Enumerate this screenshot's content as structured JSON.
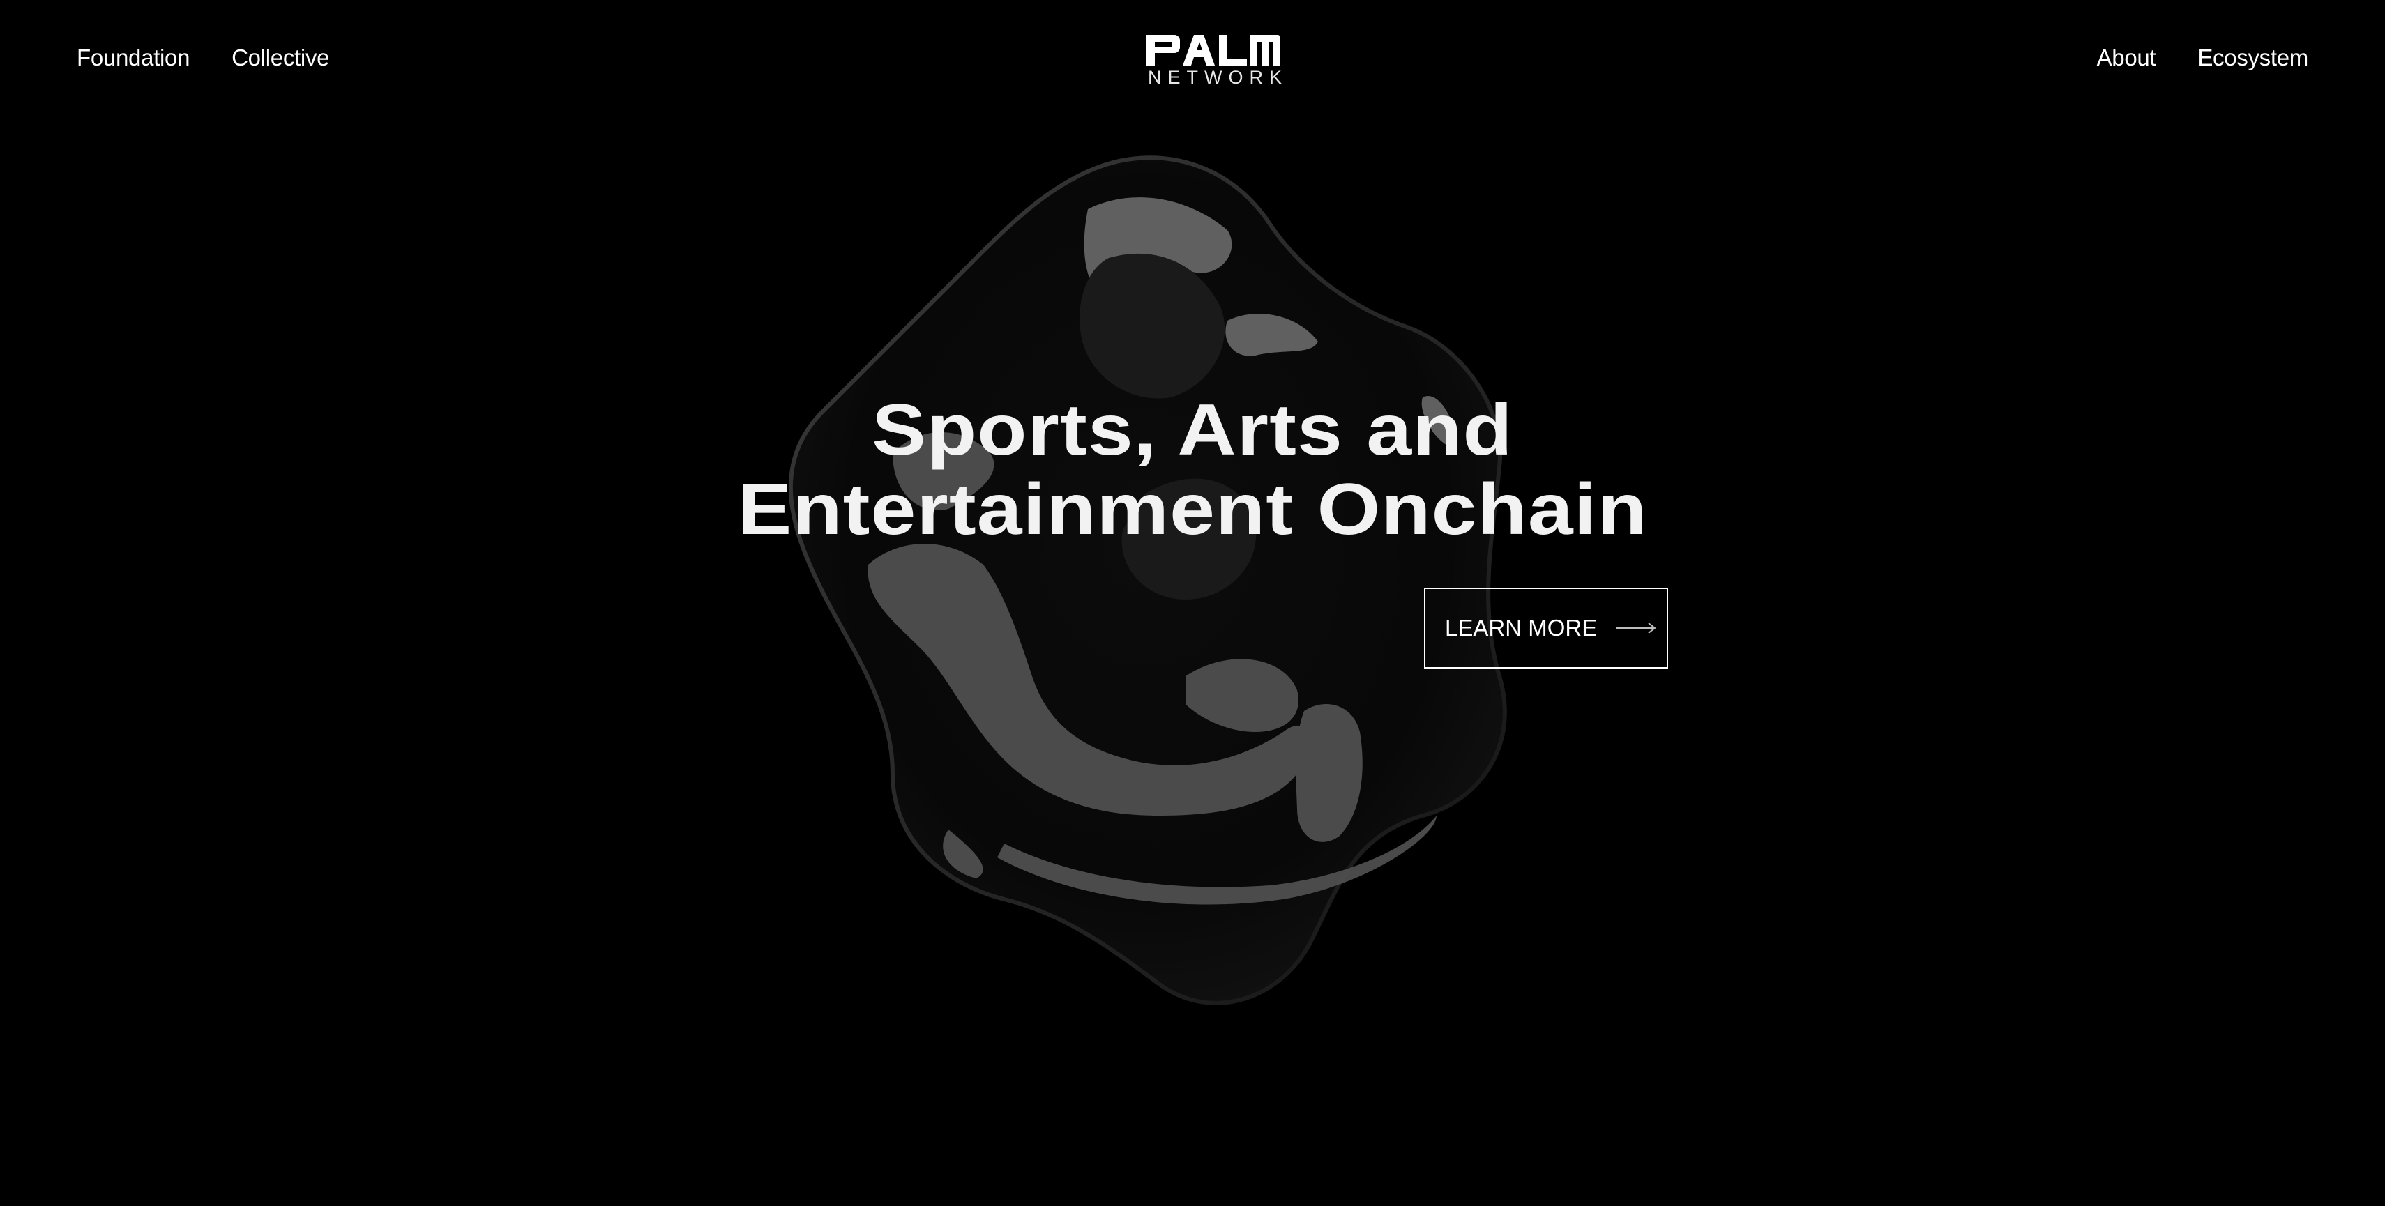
{
  "nav_left": [
    {
      "label": "Foundation"
    },
    {
      "label": "Collective"
    }
  ],
  "nav_right": [
    {
      "label": "About"
    },
    {
      "label": "Ecosystem"
    }
  ],
  "logo": {
    "mark_text": "PALM",
    "subtext": "NETWORK"
  },
  "hero": {
    "title_line1": "Sports, Arts and",
    "title_line2": "Entertainment Onchain",
    "cta_label": "LEARN MORE",
    "cta_icon": "arrow-right-icon"
  },
  "colors": {
    "background": "#000000",
    "text": "#ffffff",
    "blob_highlight": "#5a5a5a"
  }
}
